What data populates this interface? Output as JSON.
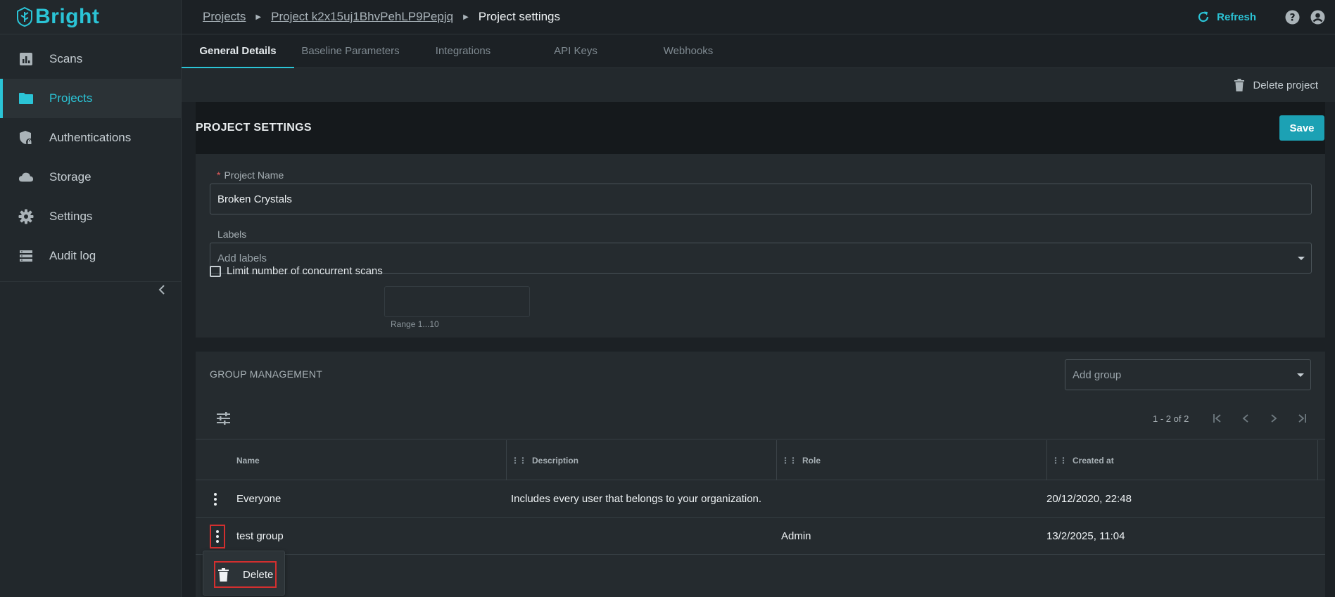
{
  "app": {
    "logo_text": "Bright"
  },
  "sidebar": {
    "items": [
      {
        "label": "Scans",
        "icon": "bar-chart-icon"
      },
      {
        "label": "Projects",
        "icon": "folder-icon",
        "active": true
      },
      {
        "label": "Authentications",
        "icon": "shield-lock-icon"
      },
      {
        "label": "Storage",
        "icon": "cloud-icon"
      },
      {
        "label": "Settings",
        "icon": "gear-icon"
      },
      {
        "label": "Audit log",
        "icon": "list-icon"
      }
    ]
  },
  "breadcrumb": {
    "items": [
      "Projects",
      "Project k2x15uj1BhvPehLP9Pepjq"
    ],
    "current": "Project settings"
  },
  "header": {
    "refresh_label": "Refresh"
  },
  "tabs": [
    {
      "label": "General Details",
      "active": true
    },
    {
      "label": "Baseline Parameters"
    },
    {
      "label": "Integrations"
    },
    {
      "label": "API Keys"
    },
    {
      "label": "Webhooks"
    }
  ],
  "actions": {
    "delete_project_label": "Delete project"
  },
  "project_settings": {
    "title": "PROJECT SETTINGS",
    "save_label": "Save",
    "name_label": "Project Name",
    "name_required_mark": "*",
    "name_value": "Broken Crystals",
    "labels_label": "Labels",
    "labels_placeholder": "Add labels",
    "limit_label": "Limit number of concurrent scans",
    "limit_checked": false,
    "range_hint": "Range 1...10"
  },
  "group_management": {
    "title": "GROUP MANAGEMENT",
    "add_group_placeholder": "Add group",
    "pagination": "1 - 2 of 2",
    "columns": [
      "Name",
      "Description",
      "Role",
      "Created at"
    ],
    "rows": [
      {
        "name": "Everyone",
        "description": "Includes every user that belongs to your organization.",
        "role": "",
        "created_at": "20/12/2020, 22:48"
      },
      {
        "name": "test group",
        "description": "",
        "role": "Admin",
        "created_at": "13/2/2025, 11:04"
      }
    ]
  },
  "context_menu": {
    "delete_label": "Delete"
  },
  "colors": {
    "accent": "#2bc4d6",
    "save_button": "#1ca1b4",
    "highlight": "#d32f2f",
    "background": "#1c2125"
  }
}
